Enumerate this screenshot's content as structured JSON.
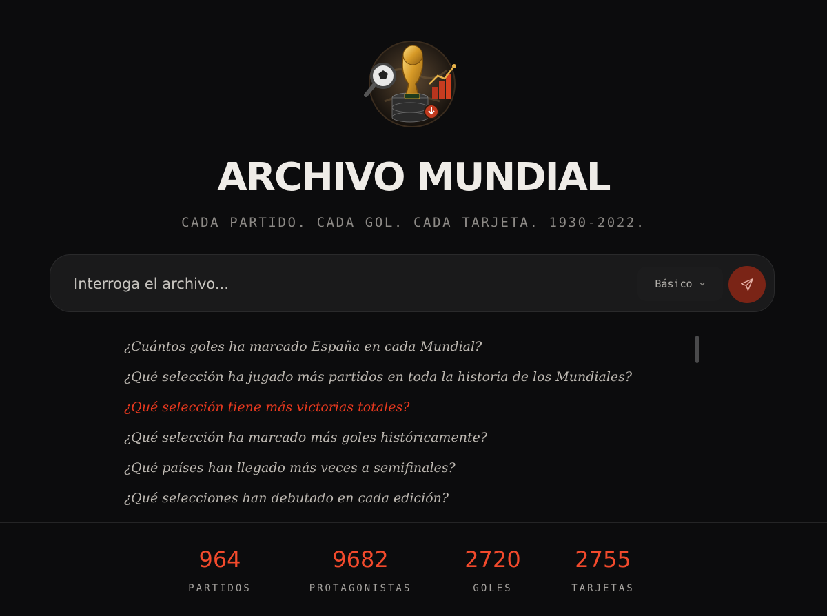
{
  "header": {
    "title": "ARCHIVO MUNDIAL",
    "subtitle": "CADA PARTIDO. CADA GOL. CADA TARJETA. 1930-2022."
  },
  "search": {
    "placeholder": "Interroga el archivo...",
    "value": "",
    "mode_label": "Básico",
    "send_icon": "send-icon"
  },
  "suggestions": [
    "¿Cuántos goles ha marcado España en cada Mundial?",
    "¿Qué selección ha jugado más partidos en toda la historia de los Mundiales?",
    "¿Qué selección tiene más victorias totales?",
    "¿Qué selección ha marcado más goles históricamente?",
    "¿Qué países han llegado más veces a semifinales?",
    "¿Qué selecciones han debutado en cada edición?"
  ],
  "active_suggestion_index": 2,
  "stats": [
    {
      "value": "964",
      "label": "PARTIDOS"
    },
    {
      "value": "9682",
      "label": "PROTAGONISTAS"
    },
    {
      "value": "2720",
      "label": "GOLES"
    },
    {
      "value": "2755",
      "label": "TARJETAS"
    }
  ],
  "colors": {
    "background": "#0c0c0d",
    "accent": "#f24a2c",
    "active_suggestion": "#e8391f",
    "send_button": "#7a2416"
  },
  "logo_icon": "world-cup-trophy-logo"
}
